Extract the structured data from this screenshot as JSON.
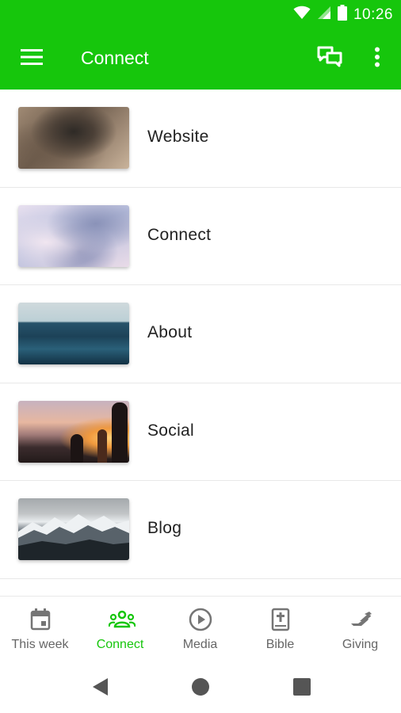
{
  "status_bar": {
    "time": "10:26"
  },
  "app_bar": {
    "title": "Connect",
    "menu_icon": "hamburger-menu-icon",
    "chat_icon": "chat-icon",
    "more_icon": "more-vert-icon",
    "color": "#16c60c"
  },
  "list": {
    "items": [
      {
        "label": "Website"
      },
      {
        "label": "Connect"
      },
      {
        "label": "About"
      },
      {
        "label": "Social"
      },
      {
        "label": "Blog"
      }
    ]
  },
  "bottom_nav": {
    "active_color": "#16c60c",
    "items": [
      {
        "label": "This week",
        "icon": "calendar-icon",
        "active": false
      },
      {
        "label": "Connect",
        "icon": "people-icon",
        "active": true
      },
      {
        "label": "Media",
        "icon": "play-circle-icon",
        "active": false
      },
      {
        "label": "Bible",
        "icon": "bible-icon",
        "active": false
      },
      {
        "label": "Giving",
        "icon": "giving-hand-icon",
        "active": false
      }
    ]
  }
}
